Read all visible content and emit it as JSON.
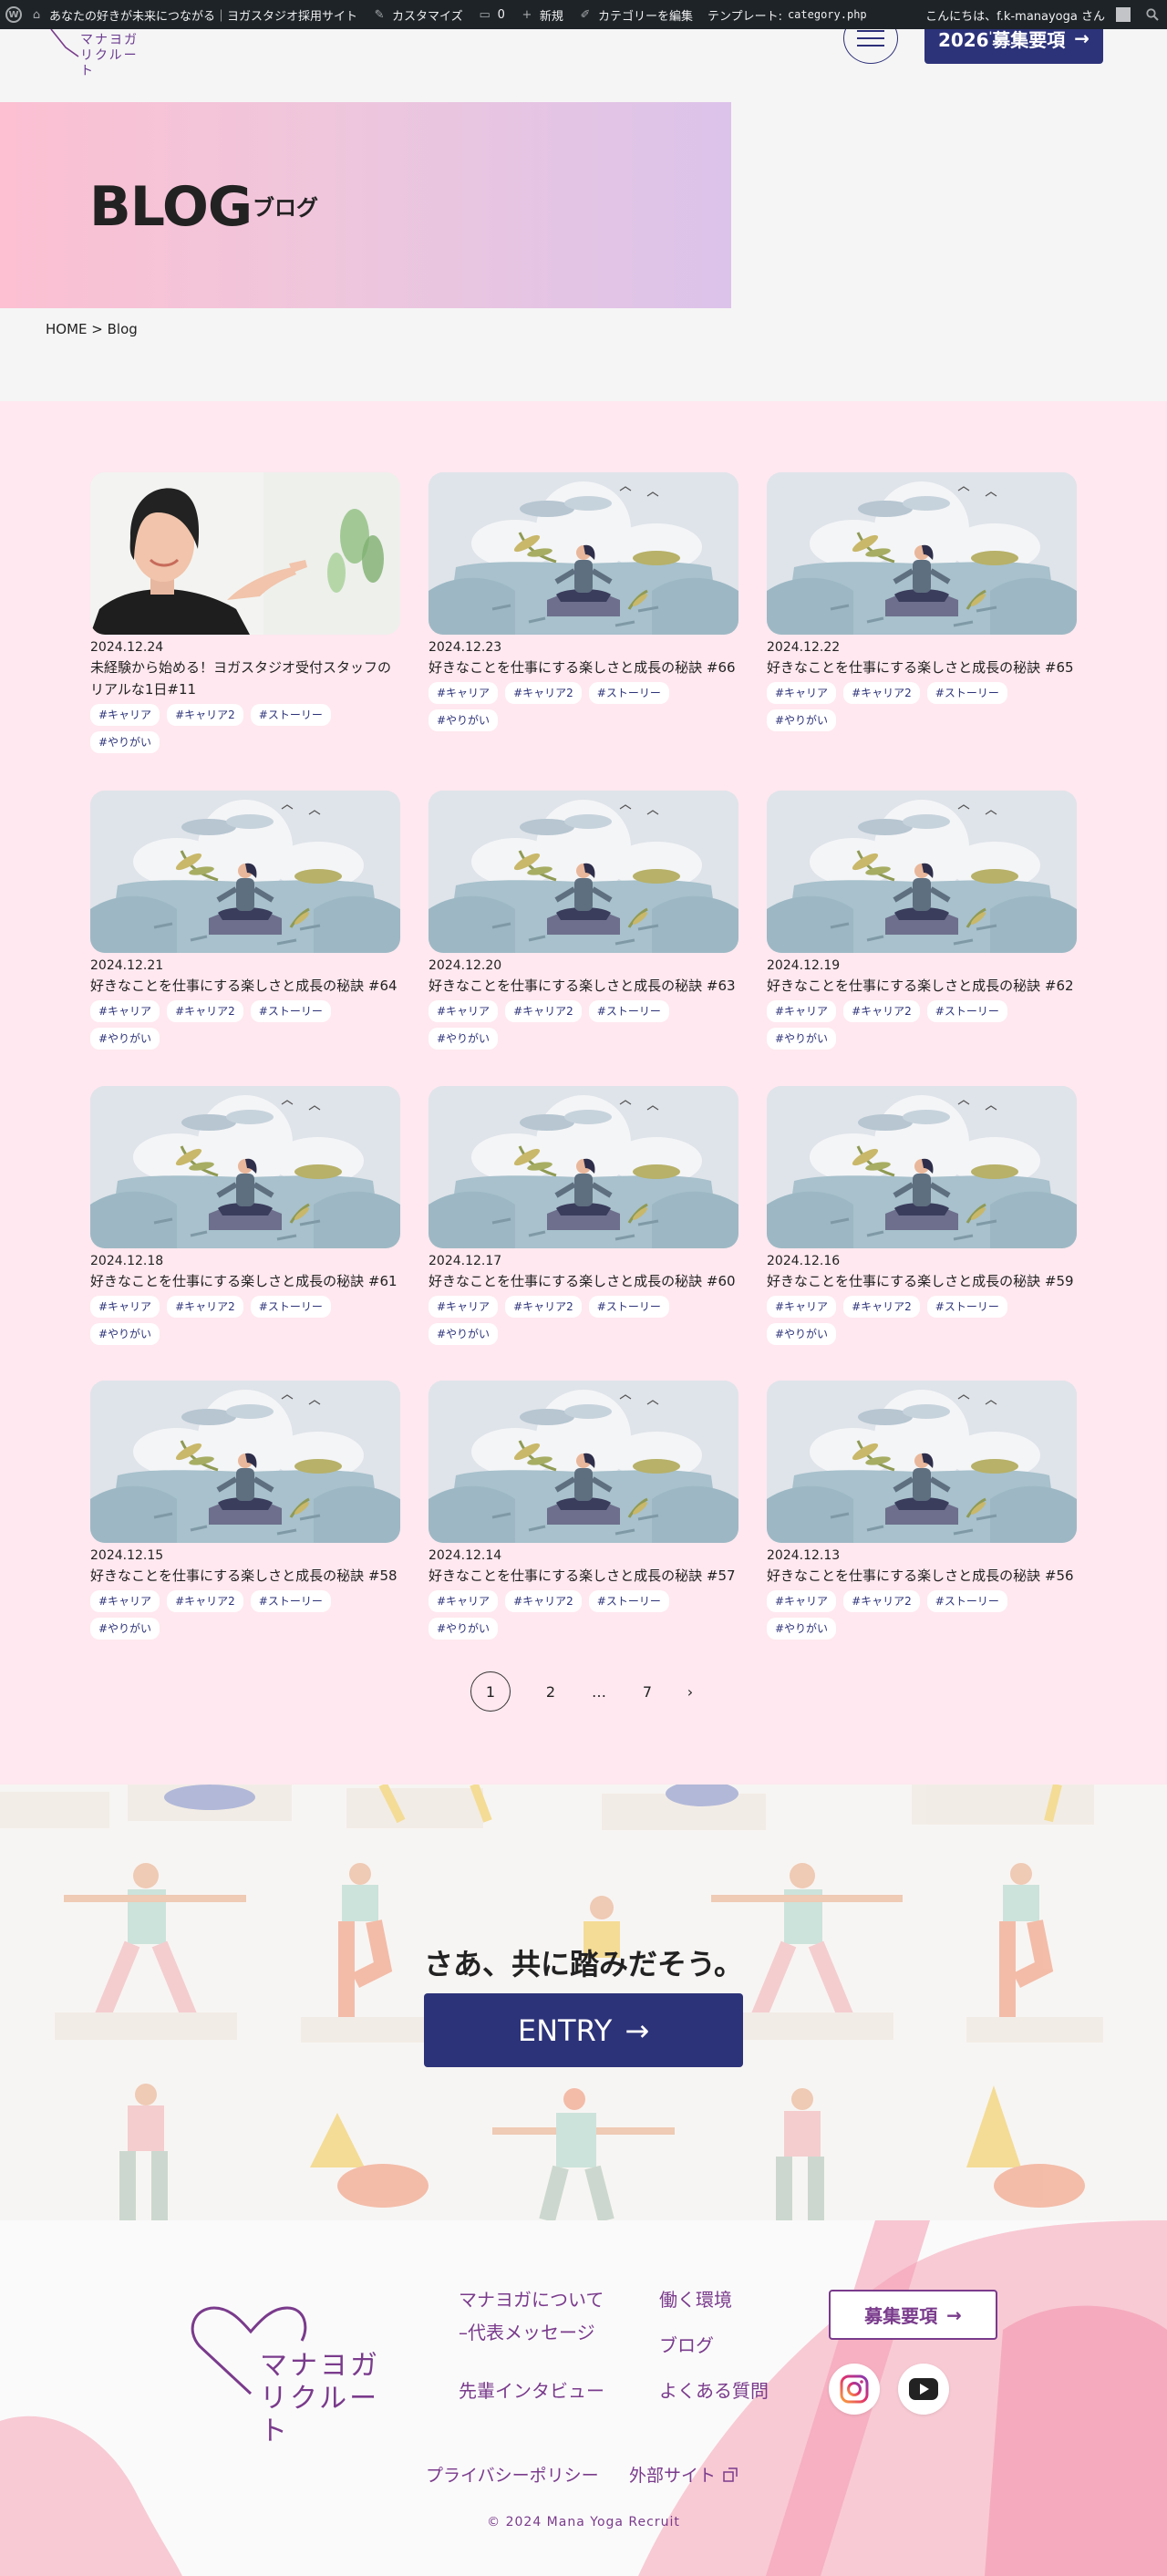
{
  "admin_bar": {
    "site_title": "あなたの好きが未来につながる｜ヨガスタジオ採用サイト",
    "customize": "カスタマイズ",
    "comments_count": "0",
    "new": "新規",
    "edit_category": "カテゴリーを編集",
    "template_label": "テンプレート:",
    "template_file": "category.php",
    "greeting": "こんにちは、f.k-manayoga さん"
  },
  "header": {
    "logo_line1": "マナヨガ",
    "logo_line2": "リクルート",
    "recruit_year": "2026",
    "recruit_suffix": "募集要項",
    "arrow": "→"
  },
  "hero": {
    "title": "BLOG",
    "subtitle": "ブログ"
  },
  "breadcrumb": "HOME > Blog",
  "posts": [
    {
      "date": "2024.12.24",
      "title": "未経験から始める！ヨガスタジオ受付スタッフのリアルな1日#11",
      "image": "portrait",
      "tags": [
        "#キャリア",
        "#キャリア2",
        "#ストーリー",
        "#やりがい"
      ]
    },
    {
      "date": "2024.12.23",
      "title": "好きなことを仕事にする楽しさと成長の秘訣 #66",
      "image": "yoga",
      "tags": [
        "#キャリア",
        "#キャリア2",
        "#ストーリー",
        "#やりがい"
      ]
    },
    {
      "date": "2024.12.22",
      "title": "好きなことを仕事にする楽しさと成長の秘訣 #65",
      "image": "yoga",
      "tags": [
        "#キャリア",
        "#キャリア2",
        "#ストーリー",
        "#やりがい"
      ]
    },
    {
      "date": "2024.12.21",
      "title": "好きなことを仕事にする楽しさと成長の秘訣 #64",
      "image": "yoga",
      "tags": [
        "#キャリア",
        "#キャリア2",
        "#ストーリー",
        "#やりがい"
      ]
    },
    {
      "date": "2024.12.20",
      "title": "好きなことを仕事にする楽しさと成長の秘訣 #63",
      "image": "yoga",
      "tags": [
        "#キャリア",
        "#キャリア2",
        "#ストーリー",
        "#やりがい"
      ]
    },
    {
      "date": "2024.12.19",
      "title": "好きなことを仕事にする楽しさと成長の秘訣 #62",
      "image": "yoga",
      "tags": [
        "#キャリア",
        "#キャリア2",
        "#ストーリー",
        "#やりがい"
      ]
    },
    {
      "date": "2024.12.18",
      "title": "好きなことを仕事にする楽しさと成長の秘訣 #61",
      "image": "yoga",
      "tags": [
        "#キャリア",
        "#キャリア2",
        "#ストーリー",
        "#やりがい"
      ]
    },
    {
      "date": "2024.12.17",
      "title": "好きなことを仕事にする楽しさと成長の秘訣 #60",
      "image": "yoga",
      "tags": [
        "#キャリア",
        "#キャリア2",
        "#ストーリー",
        "#やりがい"
      ]
    },
    {
      "date": "2024.12.16",
      "title": "好きなことを仕事にする楽しさと成長の秘訣 #59",
      "image": "yoga",
      "tags": [
        "#キャリア",
        "#キャリア2",
        "#ストーリー",
        "#やりがい"
      ]
    },
    {
      "date": "2024.12.15",
      "title": "好きなことを仕事にする楽しさと成長の秘訣 #58",
      "image": "yoga",
      "tags": [
        "#キャリア",
        "#キャリア2",
        "#ストーリー",
        "#やりがい"
      ]
    },
    {
      "date": "2024.12.14",
      "title": "好きなことを仕事にする楽しさと成長の秘訣 #57",
      "image": "yoga",
      "tags": [
        "#キャリア",
        "#キャリア2",
        "#ストーリー",
        "#やりがい"
      ]
    },
    {
      "date": "2024.12.13",
      "title": "好きなことを仕事にする楽しさと成長の秘訣 #56",
      "image": "yoga",
      "tags": [
        "#キャリア",
        "#キャリア2",
        "#ストーリー",
        "#やりがい"
      ]
    }
  ],
  "pagination": {
    "items": [
      "1",
      "2",
      "…",
      "7",
      "›"
    ],
    "current": "1"
  },
  "entry": {
    "title": "さあ、共に踏みだそう。",
    "button_label": "ENTRY",
    "arrow": "→"
  },
  "footer": {
    "logo_line1": "マナヨガ",
    "logo_line2": "リクルート",
    "about": "マナヨガについて",
    "message": "–代表メッセージ",
    "interview": "先輩インタビュー",
    "environment": "働く環境",
    "blog": "ブログ",
    "faq": "よくある質問",
    "recruit_button": "募集要項",
    "arrow": "→",
    "privacy": "プライバシーポリシー",
    "external": "外部サイト",
    "copyright": "© 2024 Mana Yoga Recruit"
  },
  "colors": {
    "navy": "#2d3379",
    "purple": "#7a3b8c",
    "blog_bg": "#ffe8ef",
    "hero_start": "#fcc0d2",
    "hero_end": "#dcc3ea"
  },
  "icons": {
    "wordpress": "wordpress-logo-icon",
    "customize": "brush-icon",
    "comments": "comment-bubble-icon",
    "new": "plus-icon",
    "edit": "pencil-icon",
    "search": "search-icon",
    "instagram": "instagram-icon",
    "youtube": "youtube-icon",
    "external": "external-link-icon"
  }
}
